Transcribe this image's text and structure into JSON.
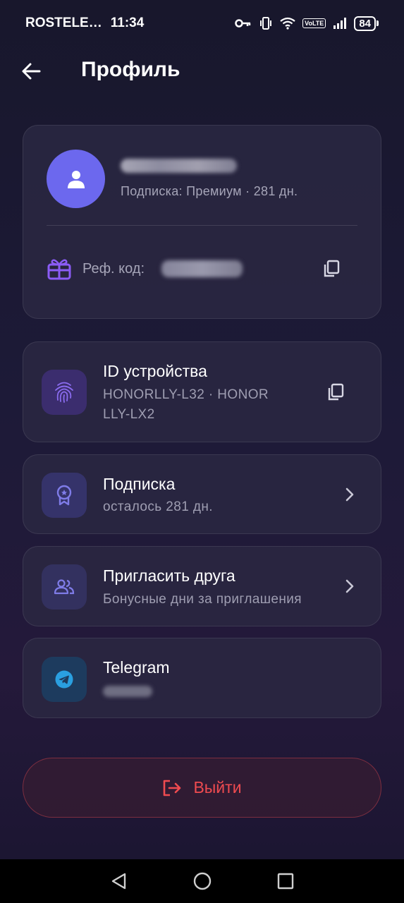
{
  "status_bar": {
    "carrier": "ROSTELE…",
    "time": "11:34",
    "volte": "VoLTE",
    "battery": "84"
  },
  "header": {
    "title": "Профиль"
  },
  "profile": {
    "subscription_info": "Подписка: Премиум · 281 дн.",
    "ref_label": "Реф. код:"
  },
  "items": [
    {
      "title": "ID устройства",
      "subtitle": "HONORLLY-L32 · HONOR LLY-LX2",
      "icon": "fingerprint-icon"
    },
    {
      "title": "Подписка",
      "subtitle": "осталось 281 дн.",
      "icon": "badge-icon"
    },
    {
      "title": "Пригласить друга",
      "subtitle": "Бонусные дни за приглашения",
      "icon": "people-icon"
    },
    {
      "title": "Telegram",
      "subtitle": "",
      "icon": "telegram-icon"
    }
  ],
  "logout": {
    "label": "Выйти"
  },
  "colors": {
    "accent": "#6c68ee",
    "danger": "#ef4b50",
    "background": "#1d1a38"
  }
}
